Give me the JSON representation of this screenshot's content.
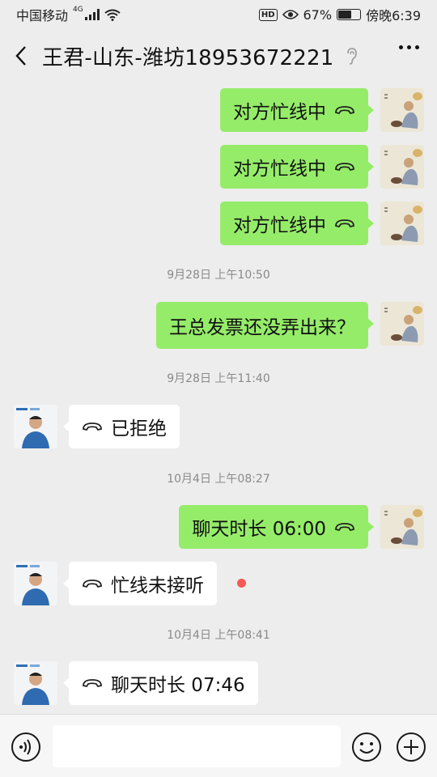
{
  "status_bar": {
    "carrier": "中国移动",
    "network": "4G",
    "battery_percent": "67%",
    "battery_level": 0.67,
    "hd_label": "HD",
    "time": "傍晚6:39"
  },
  "header": {
    "title": "王君-山东-潍坊18953672221"
  },
  "messages": [
    {
      "direction": "out",
      "text": "对方忙线中"
    },
    {
      "direction": "out",
      "text": "对方忙线中"
    },
    {
      "direction": "out",
      "text": "对方忙线中"
    },
    {
      "type": "timestamp",
      "text": "9月28日 上午10:50"
    },
    {
      "direction": "out",
      "text": "王总发票还没弄出来？"
    },
    {
      "type": "timestamp",
      "text": "9月28日 上午11:40"
    },
    {
      "direction": "in",
      "text": "已拒绝"
    },
    {
      "type": "timestamp",
      "text": "10月4日 上午08:27"
    },
    {
      "direction": "out",
      "text": "聊天时长 06:00"
    },
    {
      "direction": "in",
      "text": "忙线未接听",
      "unread": true
    },
    {
      "type": "timestamp",
      "text": "10月4日 上午08:41"
    },
    {
      "direction": "in",
      "text": "聊天时长 07:46"
    }
  ],
  "colors": {
    "background": "#ededed",
    "outgoing_bubble": "#95ec69",
    "incoming_bubble": "#ffffff",
    "unread_dot": "#f45a55"
  },
  "icons": {
    "back": "chevron-left-icon",
    "ear": "ear-icon",
    "more": "more-dots-icon",
    "call": "phone-handset-icon",
    "voice": "voice-icon",
    "emoji": "emoji-icon",
    "plus": "plus-icon"
  }
}
